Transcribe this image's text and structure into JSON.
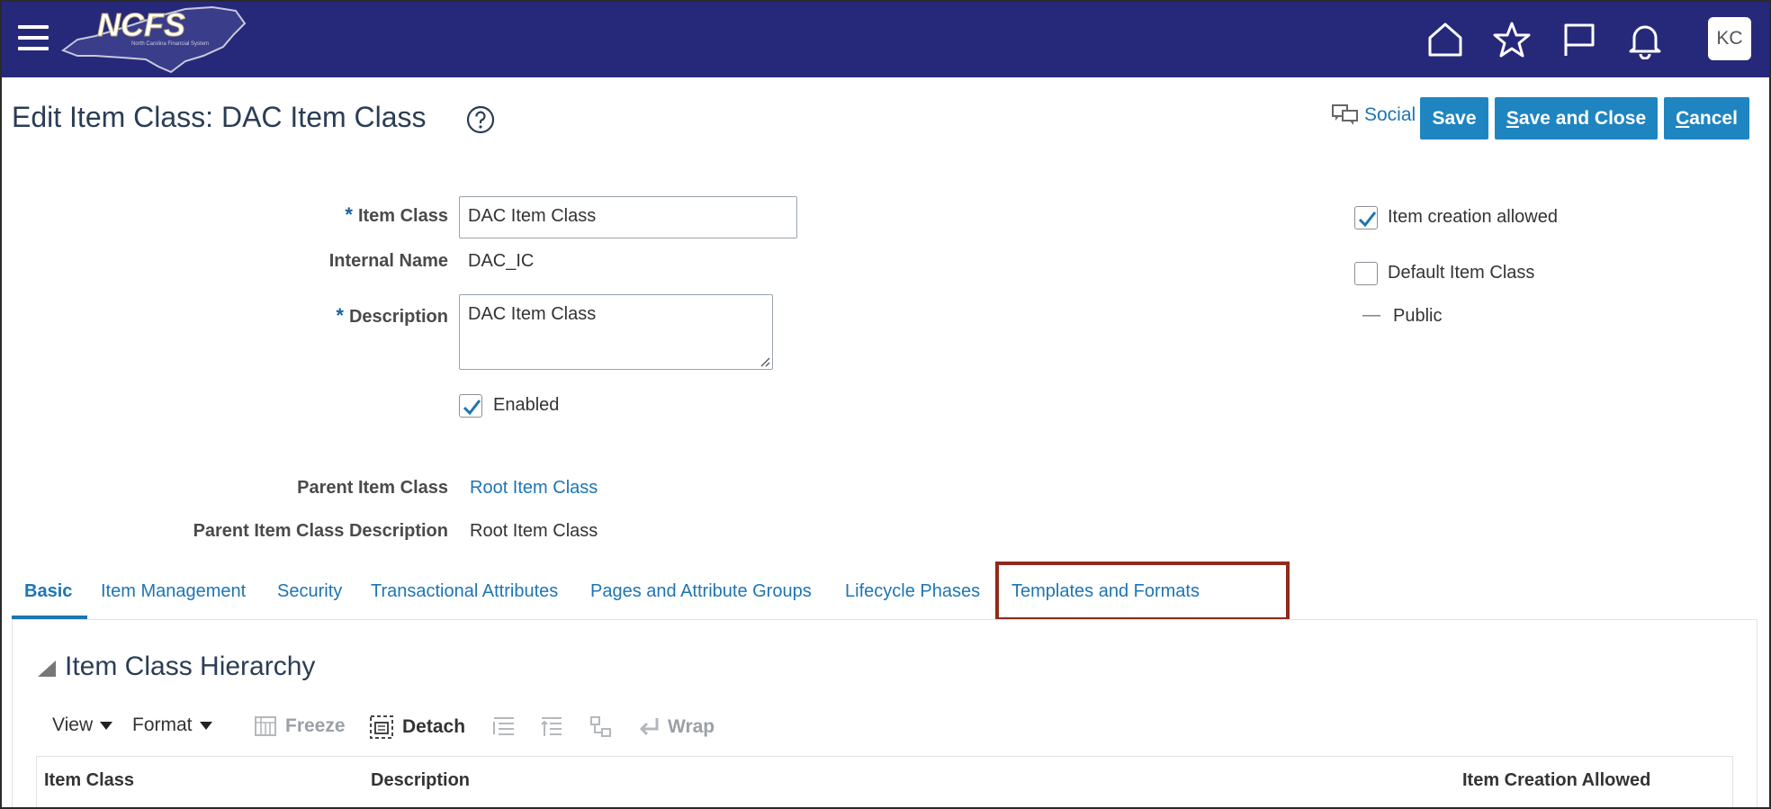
{
  "header": {
    "logo_text": "NCFS",
    "logo_subtext": "North Carolina Financial System",
    "avatar_initials": "KC",
    "icons": [
      "menu-icon",
      "home-icon",
      "star-icon",
      "flag-icon",
      "bell-icon"
    ]
  },
  "page": {
    "title": "Edit Item Class: DAC Item Class",
    "social_label": "Social",
    "buttons": {
      "save": "Save",
      "save_and_close_first": "S",
      "save_and_close_rest": "ave and Close",
      "cancel_first": "C",
      "cancel_rest": "ancel"
    }
  },
  "form": {
    "item_class_label": "Item Class",
    "item_class_value": "DAC Item Class",
    "internal_name_label": "Internal Name",
    "internal_name_value": "DAC_IC",
    "description_label": "Description",
    "description_value": "DAC Item Class",
    "enabled_label": "Enabled",
    "enabled_checked": true,
    "parent_item_class_label": "Parent Item Class",
    "parent_item_class_value": "Root Item Class",
    "parent_desc_label": "Parent Item Class Description",
    "parent_desc_value": "Root Item Class",
    "item_creation_allowed_label": "Item creation allowed",
    "item_creation_allowed_checked": true,
    "default_item_class_label": "Default Item Class",
    "default_item_class_checked": false,
    "public_label": "Public",
    "public_indicator": "—"
  },
  "tabs": [
    {
      "label": "Basic",
      "active": true
    },
    {
      "label": "Item Management"
    },
    {
      "label": "Security"
    },
    {
      "label": "Transactional Attributes"
    },
    {
      "label": "Pages and Attribute Groups"
    },
    {
      "label": "Lifecycle Phases"
    },
    {
      "label": "Templates and Formats",
      "highlighted": true
    }
  ],
  "hierarchy": {
    "title": "Item Class Hierarchy",
    "toolbar": {
      "view": "View",
      "format": "Format",
      "freeze": "Freeze",
      "detach": "Detach",
      "wrap": "Wrap"
    },
    "columns": [
      "Item Class",
      "Description",
      "Item Creation Allowed"
    ]
  },
  "colors": {
    "header_bg": "#26297a",
    "button_bg": "#1f85c0",
    "link": "#1d75b3",
    "highlight_box": "#8f2a1c"
  }
}
